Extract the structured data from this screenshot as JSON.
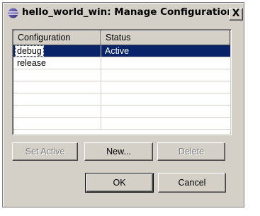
{
  "window": {
    "title": "hello_world_win: Manage Configurations",
    "close_label": "X"
  },
  "table": {
    "headers": [
      "Configuration",
      "Status"
    ],
    "rows": [
      {
        "configuration": "debug",
        "status": "Active",
        "selected": true
      },
      {
        "configuration": "release",
        "status": "",
        "selected": false
      }
    ]
  },
  "buttons": {
    "set_active": "Set Active",
    "new": "New...",
    "delete": "Delete",
    "ok": "OK",
    "cancel": "Cancel"
  },
  "colors": {
    "dialog_bg": "#d4d0c8",
    "selection_bg": "#0a246a",
    "selection_fg": "#ffffff",
    "disabled_text": "#808080"
  },
  "icons": {
    "title_icon": "eclipse-icon",
    "close_icon": "close-icon"
  }
}
